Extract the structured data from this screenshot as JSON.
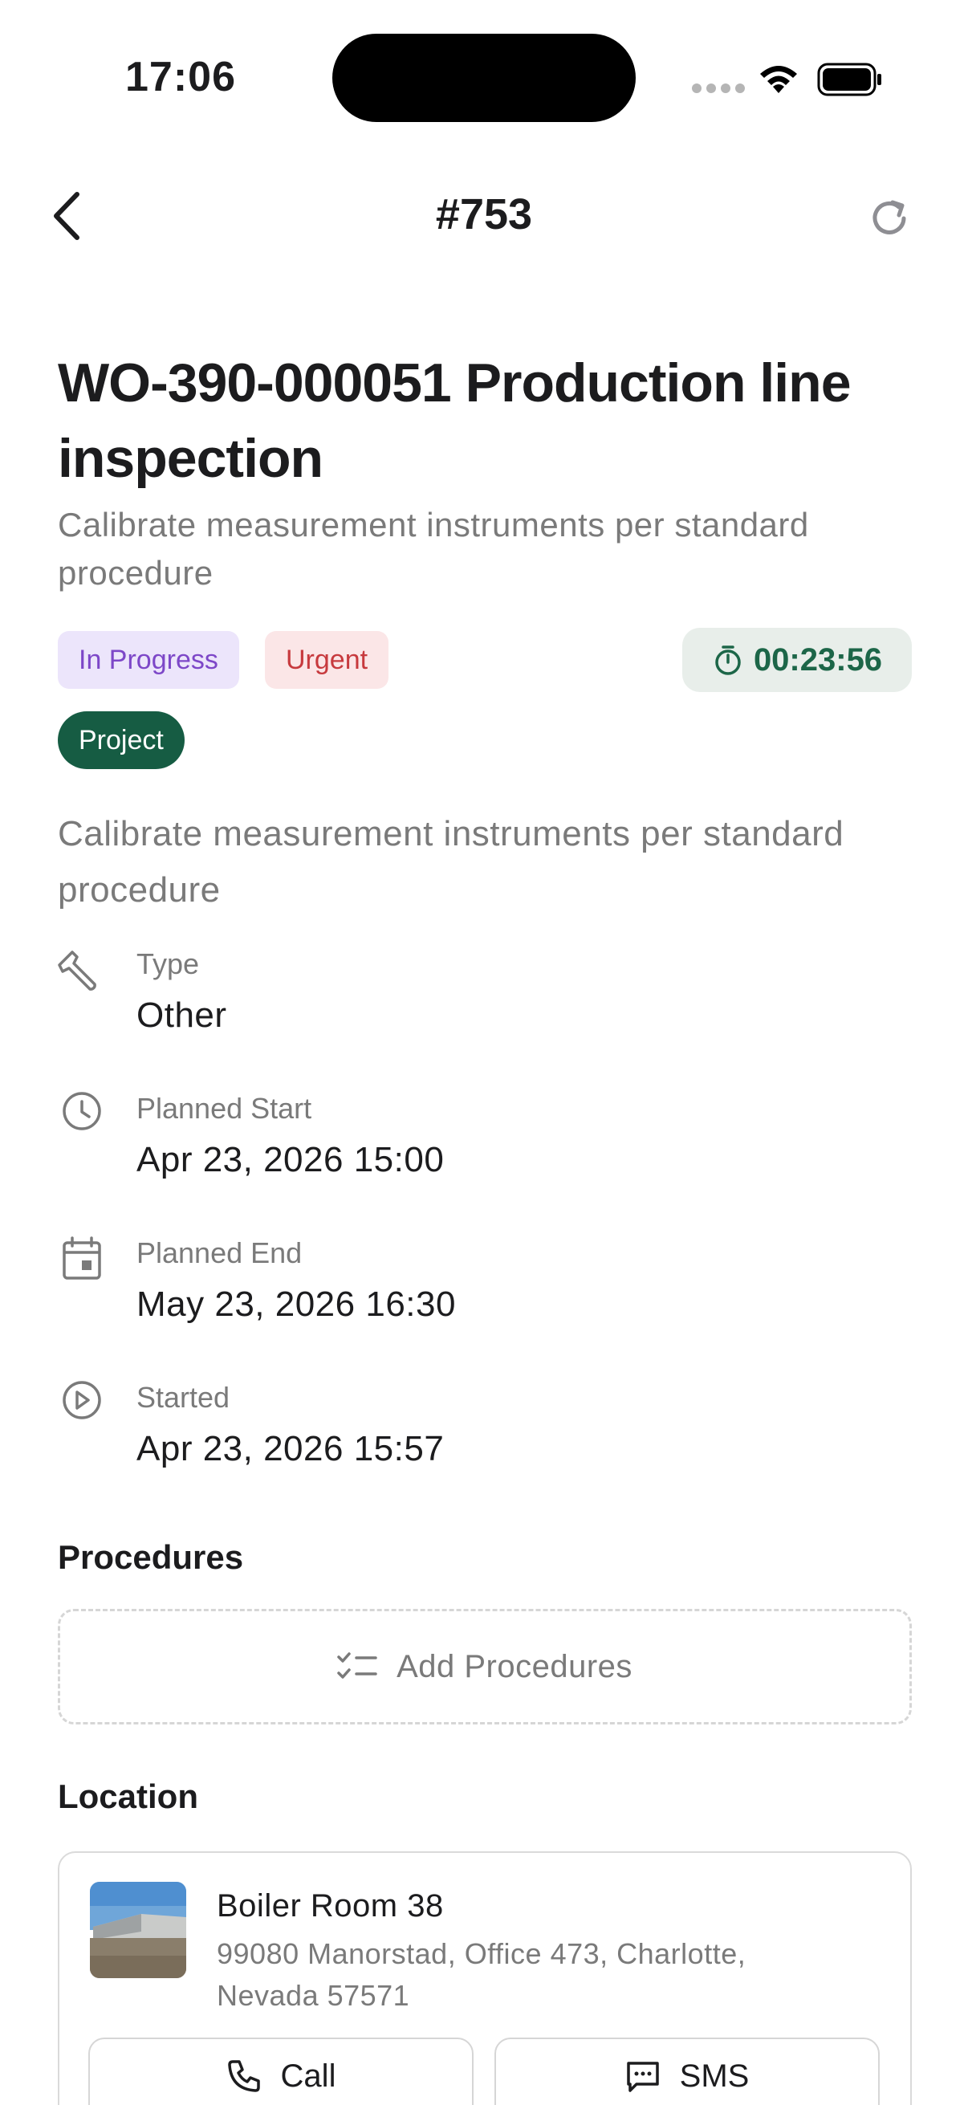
{
  "status_bar": {
    "time": "17:06"
  },
  "nav": {
    "title": "#753"
  },
  "work_order": {
    "title": "WO-390-000051 Production line inspection",
    "subtitle": "Calibrate measurement instruments per standard procedure",
    "status": "In Progress",
    "priority": "Urgent",
    "category": "Project",
    "timer": "00:23:56",
    "description": "Calibrate measurement instruments per standard procedure"
  },
  "details": [
    {
      "label": "Type",
      "value": "Other",
      "icon": "wrench-icon"
    },
    {
      "label": "Planned Start",
      "value": "Apr 23, 2026 15:00",
      "icon": "clock-icon"
    },
    {
      "label": "Planned End",
      "value": "May 23, 2026 16:30",
      "icon": "calendar-icon"
    },
    {
      "label": "Started",
      "value": "Apr 23, 2026 15:57",
      "icon": "play-circle-icon"
    }
  ],
  "procedures": {
    "title": "Procedures",
    "add_label": "Add Procedures"
  },
  "location": {
    "title": "Location",
    "name": "Boiler Room 38",
    "address": "99080 Manorstad, Office 473, Charlotte, Nevada 57571",
    "call_label": "Call",
    "sms_label": "SMS"
  },
  "colors": {
    "accent_green": "#165c43",
    "status_purple": "#7d47c8",
    "priority_red": "#c73a3e"
  }
}
